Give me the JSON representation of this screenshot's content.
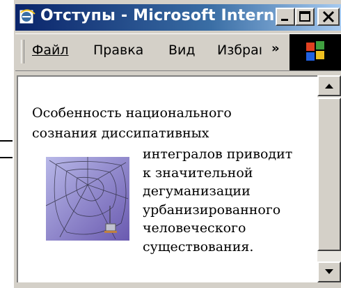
{
  "window": {
    "title": "Отступы - Microsoft Intern...",
    "controls": {
      "minimize": "_",
      "maximize": "□",
      "close": "×"
    }
  },
  "menu": {
    "items": [
      {
        "label": "Файл"
      },
      {
        "label": "Правка"
      },
      {
        "label": "Вид"
      },
      {
        "label": "Избраı"
      }
    ],
    "overflow": "»"
  },
  "document": {
    "lines": [
      "Особенность национального",
      "сознания диссипативных",
      "интегралов приводит",
      "к значительной",
      "дегуманизации",
      "урбанизированного",
      "человеческого",
      "существования."
    ],
    "image_icon": "spider-web-image"
  },
  "colors": {
    "titlebar_start": "#0a246a",
    "titlebar_end": "#a6caf0",
    "chrome": "#d4d0c8",
    "content_bg": "#ffffff"
  }
}
